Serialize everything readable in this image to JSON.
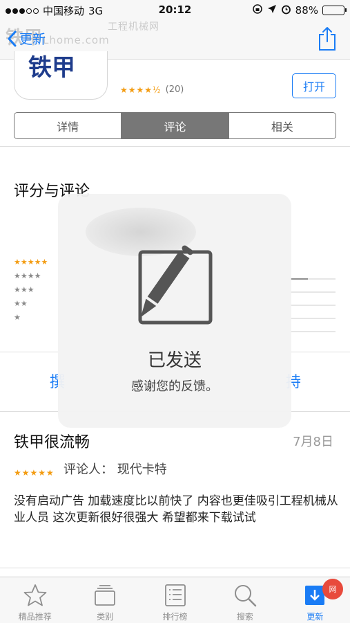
{
  "status_bar": {
    "carrier": "中国移动",
    "network": "3G",
    "time": "20:12",
    "battery": "88%",
    "battery_level": 0.88
  },
  "watermark": {
    "brand": "铁甲",
    "site": "Lhome.com",
    "tag": "工程机械网"
  },
  "nav": {
    "back_label": "更新"
  },
  "app": {
    "icon_text": "铁甲",
    "rating_count": "(20)",
    "rating_stars": "★★★★½",
    "open_label": "打开"
  },
  "tabs": [
    {
      "label": "详情",
      "active": false
    },
    {
      "label": "评论",
      "active": true
    },
    {
      "label": "相关",
      "active": false
    }
  ],
  "ratings": {
    "title": "评分与评论",
    "distribution_rows": [
      "★★★★★",
      "★★★★",
      "★★★",
      "★★",
      "★"
    ],
    "bar_fractions": [
      0.4,
      0,
      0,
      0,
      0
    ],
    "action_left_partial": "撰",
    "action_right_partial": "持"
  },
  "hud": {
    "title": "已发送",
    "subtitle": "感谢您的反馈。"
  },
  "review": {
    "title": "铁甲很流畅",
    "date": "7月8日",
    "stars": "★★★★★",
    "reviewer": "评论人：  现代卡特",
    "body": "没有启动广告   加载速度比以前快了  内容也更佳吸引工程机械从业人员   这次更新很好很强大  希望都来下载试试"
  },
  "tab_bar": {
    "items": [
      {
        "label": "精品推荐",
        "icon": "star-icon",
        "active": false
      },
      {
        "label": "类别",
        "icon": "stack-icon",
        "active": false
      },
      {
        "label": "排行榜",
        "icon": "list-icon",
        "active": false
      },
      {
        "label": "搜索",
        "icon": "search-icon",
        "active": false
      },
      {
        "label": "更新",
        "icon": "update-icon",
        "active": true
      }
    ],
    "badge": "网"
  },
  "colors": {
    "accent": "#1a7cf5",
    "star": "#f39c12",
    "segment_active": "#777777"
  }
}
